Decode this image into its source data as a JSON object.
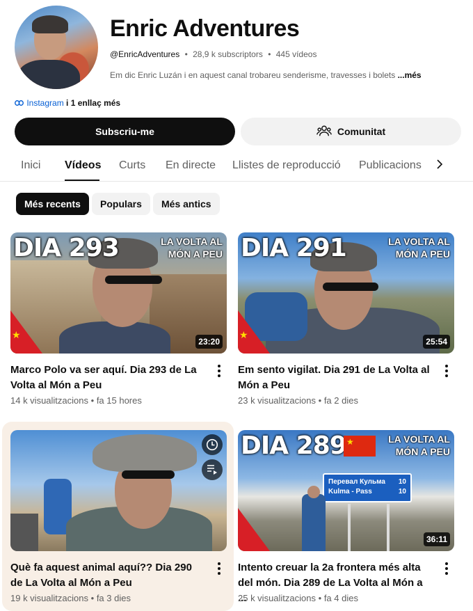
{
  "channel": {
    "name": "Enric Adventures",
    "handle": "@EnricAdventures",
    "subscribers": "28,9 k subscriptors",
    "videos_count": "445 vídeos",
    "separator": "•",
    "description": "Em dic Enric Luzán i en aquest canal trobareu senderisme, travesses i bolets",
    "more_label": "...més",
    "link_label": "Instagram",
    "link_rest": "i 1 enllaç més",
    "link_icon": "link-icon"
  },
  "actions": {
    "subscribe_label": "Subscriu-me",
    "community_label": "Comunitat",
    "community_icon": "people-icon"
  },
  "tabs": [
    {
      "label": "Inici",
      "active": false
    },
    {
      "label": "Vídeos",
      "active": true
    },
    {
      "label": "Curts",
      "active": false
    },
    {
      "label": "En directe",
      "active": false
    },
    {
      "label": "Llistes de reproducció",
      "active": false
    },
    {
      "label": "Publicacions",
      "active": false
    }
  ],
  "chips": [
    {
      "label": "Més recents",
      "active": true
    },
    {
      "label": "Populars",
      "active": false
    },
    {
      "label": "Més antics",
      "active": false
    }
  ],
  "videos": [
    {
      "title": "Marco Polo va ser aquí. Dia 293 de La Volta al Món a Peu",
      "views": "14 k visualitzacions",
      "age": "fa 15 hores",
      "duration": "23:20",
      "overlay_day": "DIA 293",
      "overlay_series": "LA VOLTA AL MÓN A PEU"
    },
    {
      "title": "Em sento vigilat. Dia 291 de La Volta al Món a Peu",
      "views": "23 k visualitzacions",
      "age": "fa 2 dies",
      "duration": "25:54",
      "overlay_day": "DIA 291",
      "overlay_series": "LA VOLTA AL MÓN A PEU"
    },
    {
      "title": "Què fa aquest animal aquí?? Dia 290 de La Volta al Món a Peu",
      "views": "19 k visualitzacions",
      "age": "fa 3 dies",
      "hover_icons": [
        "clock-icon",
        "add-to-queue-icon"
      ]
    },
    {
      "title": "Intento creuar la 2a frontera més alta del món. Dia 289 de La Volta al Món a ...",
      "views": "25 k visualitzacions",
      "age": "fa 4 dies",
      "duration": "36:11",
      "overlay_day": "DIA 289",
      "overlay_series": "LA VOLTA AL MÓN A PEU",
      "sign_line1": "Перевал Кульма",
      "sign_line2": "Kulma - Pass",
      "sign_num1": "10",
      "sign_num2": "10"
    }
  ],
  "colors": {
    "accent": "#065fd4",
    "primary_button": "#0f0f0f",
    "highlight_card": "#f8efe6"
  }
}
